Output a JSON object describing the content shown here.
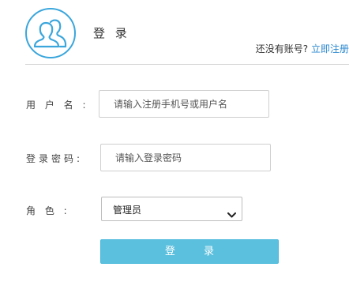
{
  "header": {
    "title": "登 录",
    "register_prompt": "还没有账号?",
    "register_link": "立即注册"
  },
  "form": {
    "username": {
      "label": "用 户 名 :",
      "placeholder": "请输入注册手机号或用户名",
      "value": ""
    },
    "password": {
      "label": "登录密码:",
      "placeholder": "请输入登录密码",
      "value": ""
    },
    "role": {
      "label": "角 色 :",
      "selected": "管理员"
    },
    "submit_label": "登 录"
  },
  "icons": {
    "logo": "users-icon",
    "dropdown": "chevron-down-icon"
  },
  "colors": {
    "accent": "#3aa6dc",
    "link": "#2d8ad0",
    "button": "#5bc0de"
  }
}
